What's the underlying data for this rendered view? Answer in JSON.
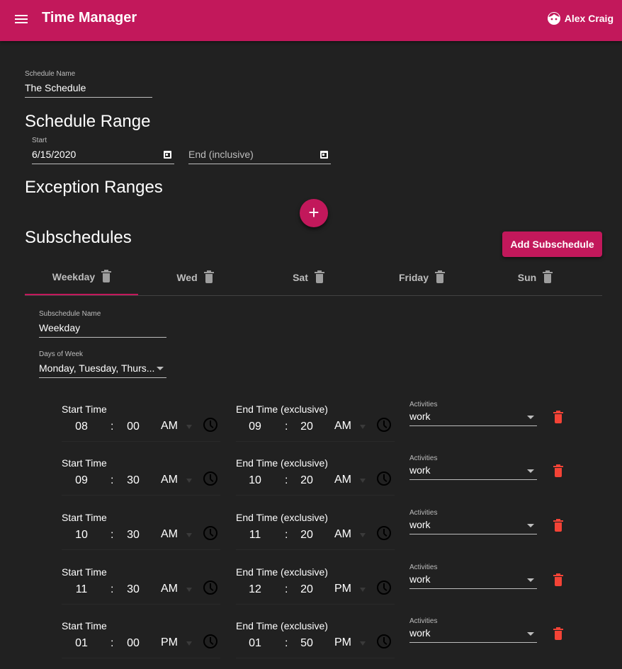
{
  "app": {
    "title": "Time Manager",
    "user_name": "Alex Craig",
    "colors": {
      "primary": "#c2185b",
      "background": "#212121",
      "danger": "#f44336"
    }
  },
  "schedule": {
    "name_label": "Schedule Name",
    "name_value": "The Schedule"
  },
  "range": {
    "heading": "Schedule Range",
    "start_label": "Start",
    "start_value": "6/15/2020",
    "end_placeholder": "End (inclusive)"
  },
  "exceptions": {
    "heading": "Exception Ranges",
    "add_icon": "+"
  },
  "subschedules": {
    "heading": "Subschedules",
    "add_button": "Add Subschedule",
    "tabs": [
      {
        "label": "Weekday",
        "active": true
      },
      {
        "label": "Wed",
        "active": false
      },
      {
        "label": "Sat",
        "active": false
      },
      {
        "label": "Friday",
        "active": false
      },
      {
        "label": "Sun",
        "active": false
      }
    ],
    "current": {
      "name_label": "Subschedule Name",
      "name_value": "Weekday",
      "days_label": "Days of Week",
      "days_value": "Monday, Tuesday, Thurs..."
    },
    "time_labels": {
      "start": "Start Time",
      "end": "End Time (exclusive)",
      "activities": "Activities",
      "colon": ":"
    },
    "entries": [
      {
        "start": {
          "h": "08",
          "m": "00",
          "ampm": "AM"
        },
        "end": {
          "h": "09",
          "m": "20",
          "ampm": "AM"
        },
        "activity": "work"
      },
      {
        "start": {
          "h": "09",
          "m": "30",
          "ampm": "AM"
        },
        "end": {
          "h": "10",
          "m": "20",
          "ampm": "AM"
        },
        "activity": "work"
      },
      {
        "start": {
          "h": "10",
          "m": "30",
          "ampm": "AM"
        },
        "end": {
          "h": "11",
          "m": "20",
          "ampm": "AM"
        },
        "activity": "work"
      },
      {
        "start": {
          "h": "11",
          "m": "30",
          "ampm": "AM"
        },
        "end": {
          "h": "12",
          "m": "20",
          "ampm": "PM"
        },
        "activity": "work"
      },
      {
        "start": {
          "h": "01",
          "m": "00",
          "ampm": "PM"
        },
        "end": {
          "h": "01",
          "m": "50",
          "ampm": "PM"
        },
        "activity": "work"
      }
    ]
  }
}
